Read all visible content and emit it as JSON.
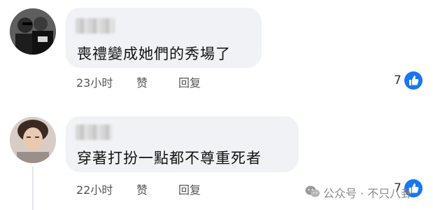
{
  "comments": [
    {
      "text": "喪禮變成她們的秀場了",
      "time": "23小时",
      "like_label": "赞",
      "reply_label": "回复",
      "reaction_count": "7"
    },
    {
      "text": "穿著打扮一點都不尊重死者",
      "time": "22小时",
      "like_label": "赞",
      "reply_label": "回复",
      "reaction_count": "7"
    }
  ],
  "watermark": {
    "text": "公众号 · 不只八卦"
  },
  "colors": {
    "bubble": "#f0f2f5",
    "like_blue": "#1877f2",
    "meta_text": "#555555"
  },
  "icons": {
    "reaction": "thumbs-up-icon",
    "watermark": "wechat-icon"
  }
}
